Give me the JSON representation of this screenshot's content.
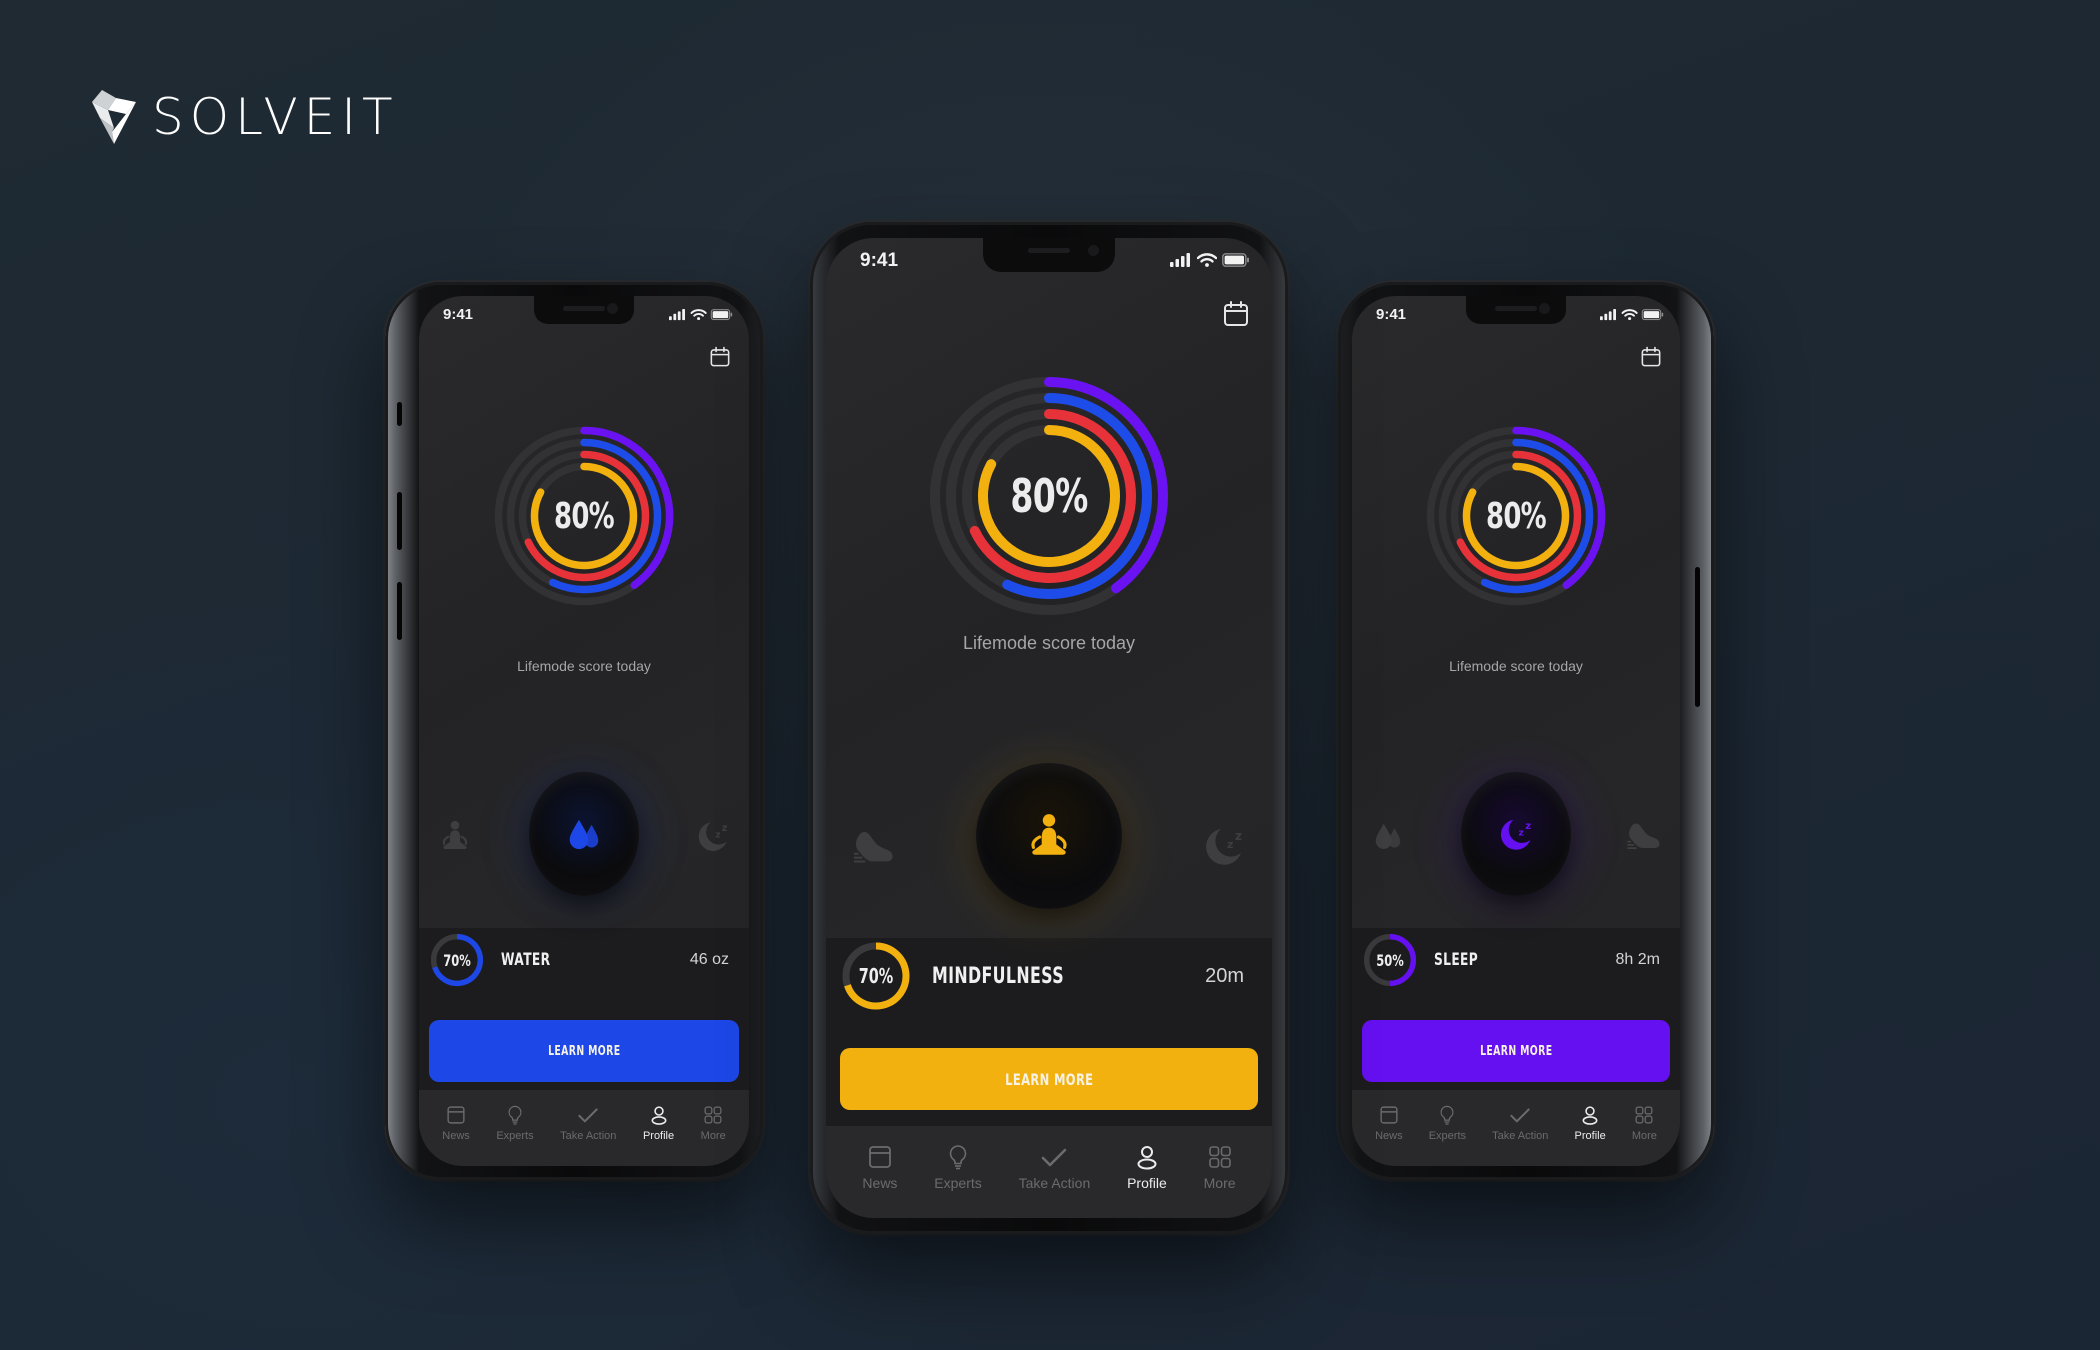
{
  "brand": {
    "name": "SOLVEIT",
    "logo_icon": "solveit-diamond-logo-icon"
  },
  "common": {
    "status_time": "9:41",
    "status_icons": [
      "signal-icon",
      "wifi-icon",
      "battery-icon"
    ],
    "calendar_icon": "calendar-icon",
    "score_value": "80%",
    "score_caption": "Lifemode score today",
    "score_rings": [
      {
        "name": "yellow-ring",
        "color": "#F2B10F",
        "fraction": 0.83
      },
      {
        "name": "red-ring",
        "color": "#E8323A",
        "fraction": 0.68
      },
      {
        "name": "blue-ring",
        "color": "#1E4CE8",
        "fraction": 0.57
      },
      {
        "name": "purple-ring",
        "color": "#6A12F2",
        "fraction": 0.4
      }
    ],
    "ring_track_color": "#323234",
    "learn_more_label": "LEARN MORE",
    "tabs": [
      {
        "label": "News",
        "icon": "news-icon",
        "active": false
      },
      {
        "label": "Experts",
        "icon": "lightbulb-icon",
        "active": false
      },
      {
        "label": "Take Action",
        "icon": "checkmark-icon",
        "active": false
      },
      {
        "label": "Profile",
        "icon": "profile-icon",
        "active": true
      },
      {
        "label": "More",
        "icon": "grid-icon",
        "active": false
      }
    ]
  },
  "phones": {
    "left": {
      "activity": "WATER",
      "active_icon": "water-drops-icon",
      "side_icons": [
        "meditation-icon",
        "sleep-moon-icon"
      ],
      "percent_label": "70%",
      "percent": 0.7,
      "value": "46 oz",
      "accent": "#1D47E6"
    },
    "center": {
      "activity": "MINDFULNESS",
      "active_icon": "meditation-icon",
      "side_icons": [
        "sneaker-icon",
        "sleep-moon-icon"
      ],
      "percent_label": "70%",
      "percent": 0.7,
      "value": "20m",
      "accent": "#F2B10F"
    },
    "right": {
      "activity": "SLEEP",
      "active_icon": "sleep-moon-icon",
      "side_icons": [
        "water-drops-icon",
        "sneaker-icon"
      ],
      "percent_label": "50%",
      "percent": 0.5,
      "value": "8h 2m",
      "accent": "#6510F0"
    }
  }
}
